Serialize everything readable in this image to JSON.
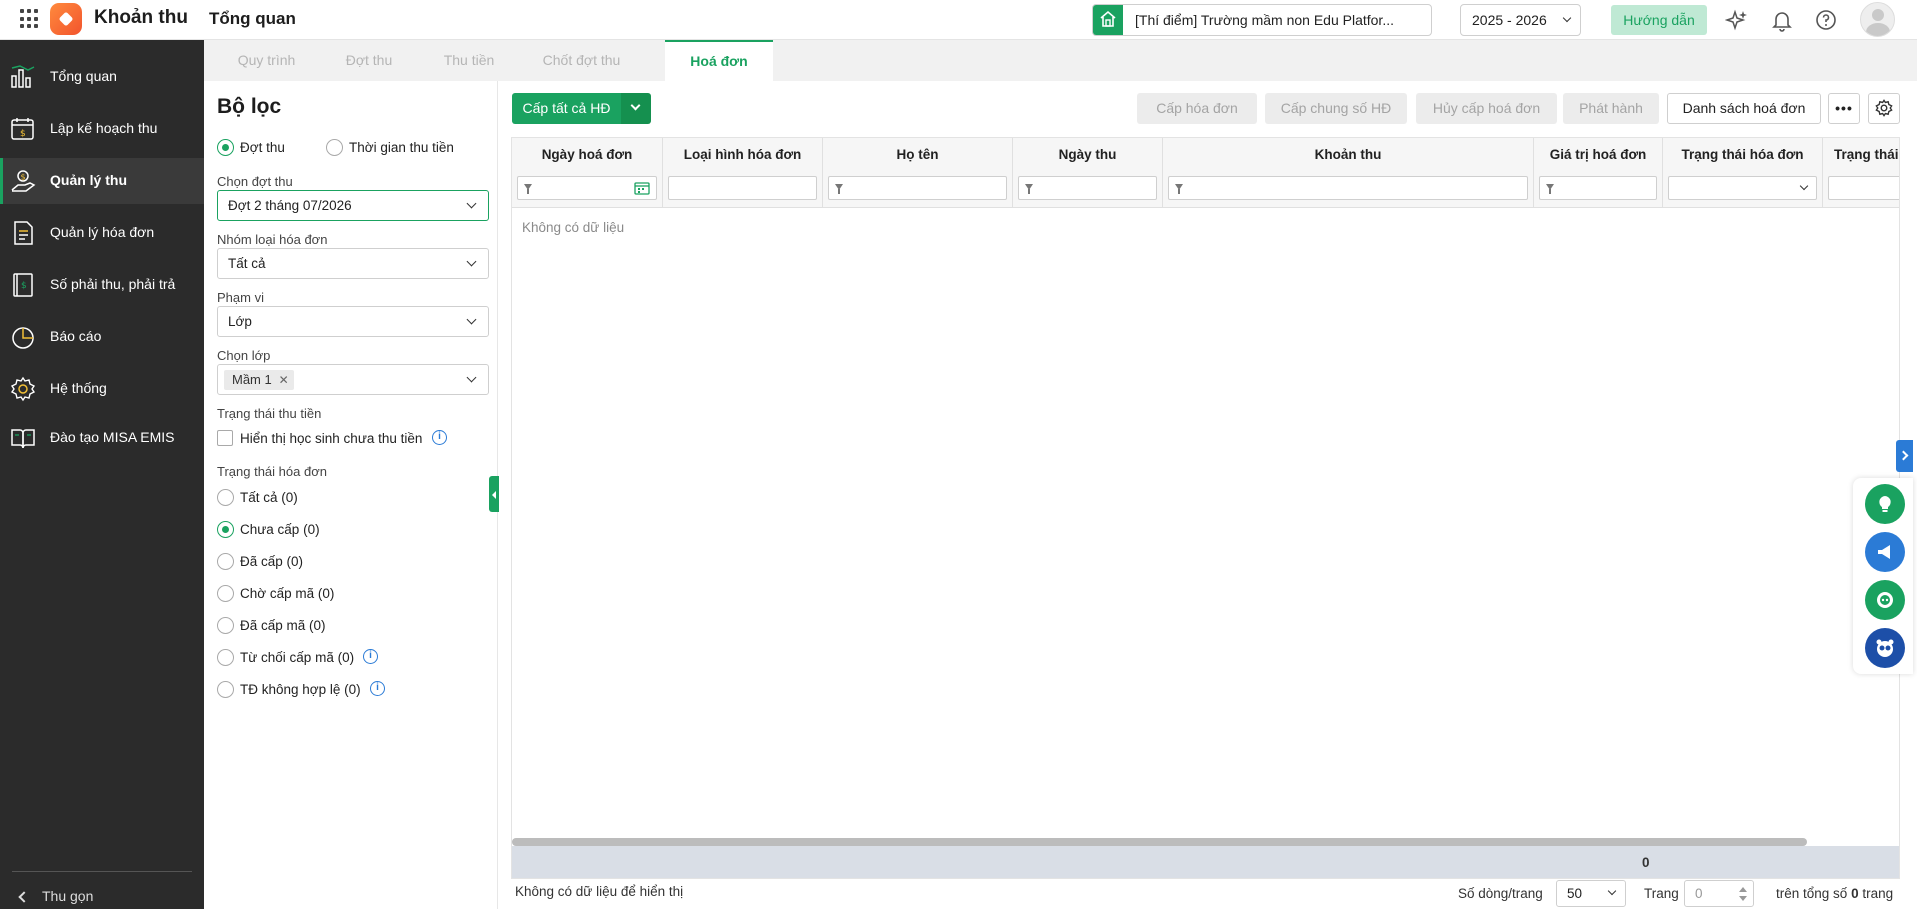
{
  "header": {
    "app_name": "Khoản thu",
    "page_title": "Tổng quan",
    "school": "[Thí điểm] Trường mầm non Edu Platfor...",
    "school_year": "2025 - 2026",
    "guide_label": "Hướng dẫn",
    "icons": [
      "apps-grid-icon",
      "sparkle-ai-icon",
      "bell-icon",
      "help-icon",
      "avatar"
    ]
  },
  "sidebar": {
    "items": [
      {
        "label": "Tổng quan",
        "icon": "bar-chart-icon"
      },
      {
        "label": "Lập kế hoạch thu",
        "icon": "calendar-dollar-icon"
      },
      {
        "label": "Quản lý thu",
        "icon": "hand-coin-icon",
        "active": true
      },
      {
        "label": "Quản lý hóa đơn",
        "icon": "invoice-icon"
      },
      {
        "label": "Số phải thu, phải trả",
        "icon": "ledger-icon"
      },
      {
        "label": "Báo cáo",
        "icon": "pie-chart-icon"
      },
      {
        "label": "Hệ thống",
        "icon": "gear-icon"
      },
      {
        "label": "Đào tạo MISA EMIS",
        "icon": "book-icon"
      }
    ],
    "collapse_label": "Thu gọn"
  },
  "tabs": [
    {
      "label": "Quy trình"
    },
    {
      "label": "Đợt thu"
    },
    {
      "label": "Thu tiền"
    },
    {
      "label": "Chốt đợt thu"
    },
    {
      "label": "Hoá đơn",
      "active": true
    }
  ],
  "filter": {
    "title": "Bộ lọc",
    "mode_options": [
      "Đợt thu",
      "Thời gian thu tiền"
    ],
    "mode_selected": "Đợt thu",
    "period_label": "Chọn đợt thu",
    "period_value": "Đợt 2 tháng 07/2026",
    "invoice_group_label": "Nhóm loại hóa đơn",
    "invoice_group_value": "Tất cả",
    "scope_label": "Phạm vi",
    "scope_value": "Lớp",
    "class_label": "Chọn lớp",
    "class_chip": "Mầm 1",
    "payment_status_label": "Trạng thái thu tiền",
    "show_unpaid_label": "Hiển thị học sinh chưa thu tiền",
    "invoice_status_label": "Trạng thái hóa đơn",
    "invoice_status_options": [
      {
        "label": "Tất cả (0)",
        "selected": false,
        "info": false
      },
      {
        "label": "Chưa cấp (0)",
        "selected": true,
        "info": false
      },
      {
        "label": "Đã cấp (0)",
        "selected": false,
        "info": false
      },
      {
        "label": "Chờ cấp mã (0)",
        "selected": false,
        "info": false
      },
      {
        "label": "Đã cấp mã (0)",
        "selected": false,
        "info": false
      },
      {
        "label": "Từ chối cấp mã (0)",
        "selected": false,
        "info": true
      },
      {
        "label": "TĐ không hợp lệ (0)",
        "selected": false,
        "info": true
      }
    ]
  },
  "toolbar": {
    "issue_all": "Cấp tất cả HĐ",
    "issue_invoice": "Cấp hóa đơn",
    "issue_shared_number": "Cấp chung số HĐ",
    "cancel_issue": "Hủy cấp hoá đơn",
    "publish": "Phát hành",
    "invoice_list": "Danh sách hoá đơn"
  },
  "grid": {
    "columns": [
      "Ngày hoá đơn",
      "Loại hình hóa đơn",
      "Họ tên",
      "Ngày thu",
      "Khoản thu",
      "Giá trị hoá đơn",
      "Trạng thái hóa đơn",
      "Trạng thái"
    ],
    "empty_text": "Không có dữ liệu",
    "total_value": "0"
  },
  "pager": {
    "no_data_text": "Không có dữ liệu để hiển thị",
    "rows_per_page_label": "Số dòng/trang",
    "rows_per_page": "50",
    "page_label": "Trang",
    "page_value": "0",
    "total_prefix": "trên tổng số",
    "total_pages": "0",
    "total_suffix": "trang"
  },
  "colors": {
    "accent": "#1aa260",
    "sidebar_bg": "#2b2b2b",
    "info_blue": "#2b7bd6"
  }
}
